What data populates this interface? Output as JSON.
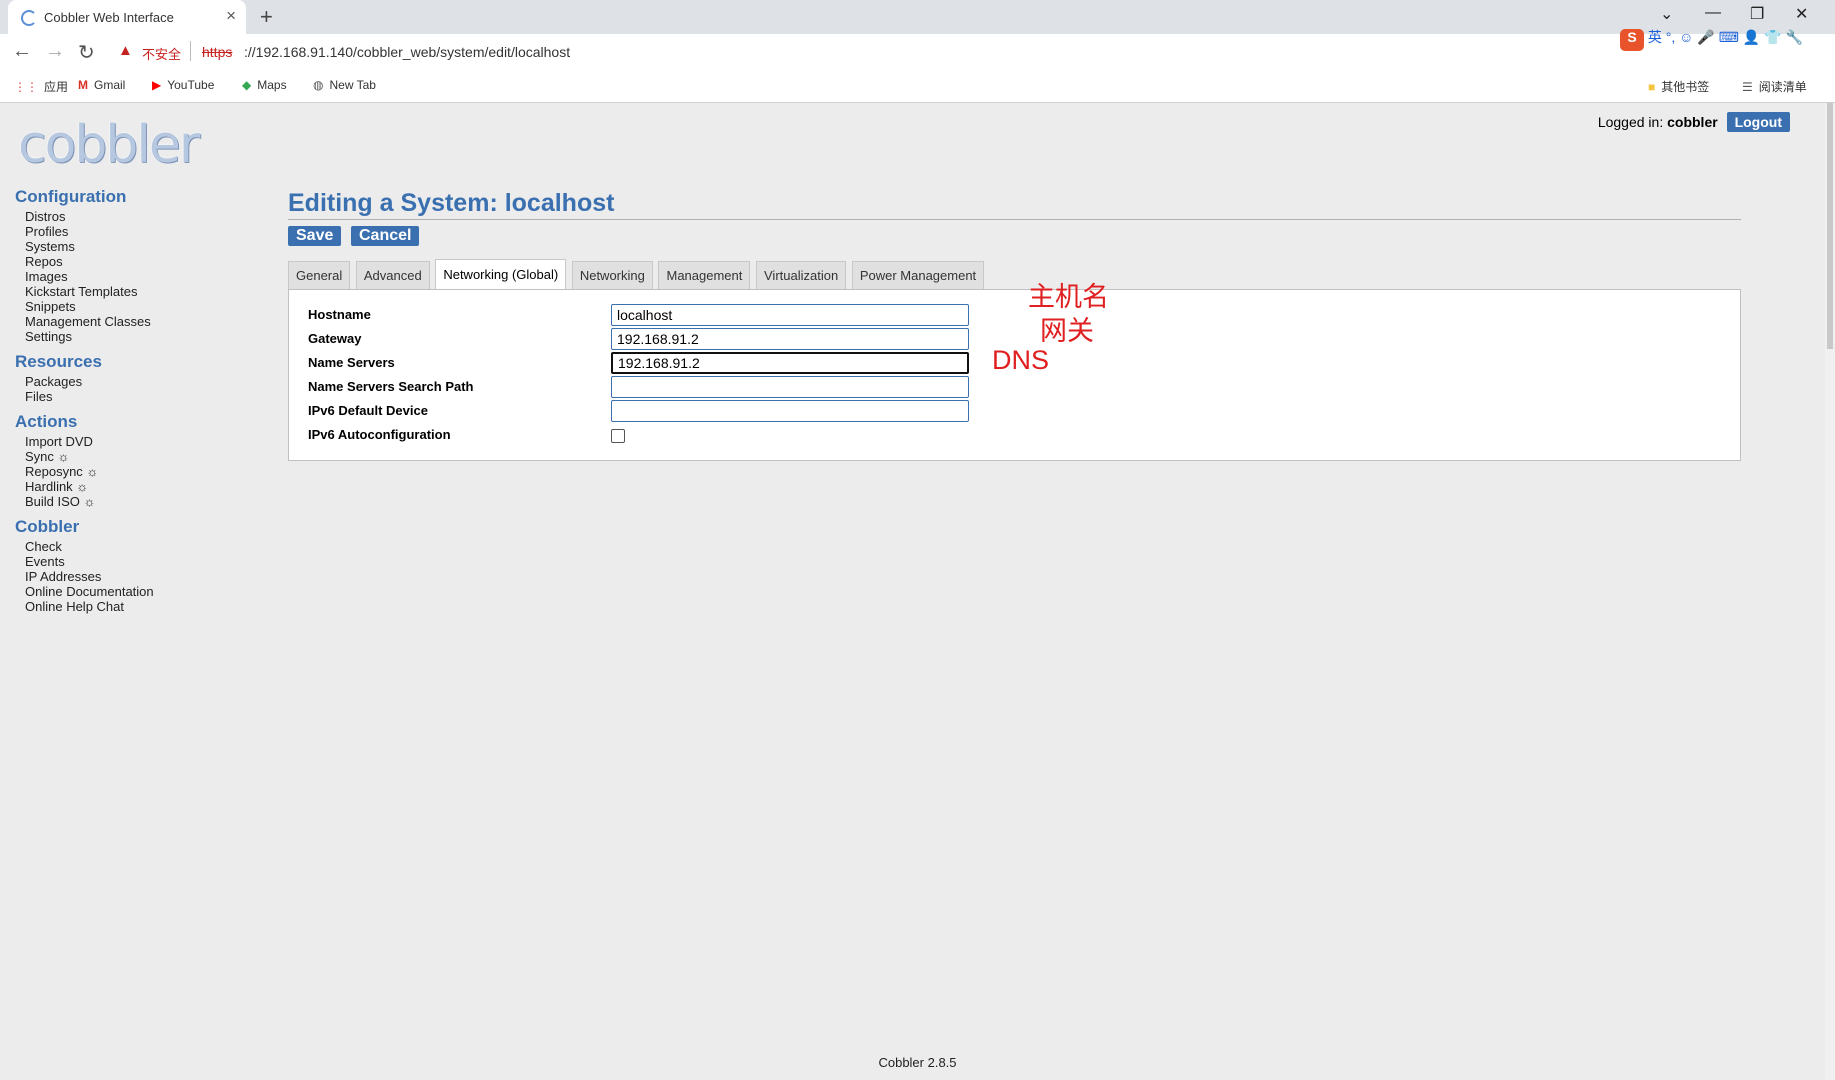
{
  "browser": {
    "tab_title": "Cobbler Web Interface",
    "insecure_label": "不安全",
    "url_scheme": "https",
    "url_rest": "://192.168.91.140/cobbler_web/system/edit/localhost",
    "bookmarks": [
      "应用",
      "Gmail",
      "YouTube",
      "Maps",
      "New Tab"
    ],
    "bookmarks_right": [
      "其他书签",
      "阅读清单"
    ],
    "ime_label": "英"
  },
  "header": {
    "logo_text": "cobbler",
    "logged_in_label": "Logged in:",
    "username": "cobbler",
    "logout_label": "Logout"
  },
  "sidebar": {
    "sections": [
      {
        "title": "Configuration",
        "items": [
          "Distros",
          "Profiles",
          "Systems",
          "Repos",
          "Images",
          "Kickstart Templates",
          "Snippets",
          "Management Classes",
          "Settings"
        ]
      },
      {
        "title": "Resources",
        "items": [
          "Packages",
          "Files"
        ]
      },
      {
        "title": "Actions",
        "items": [
          "Import DVD",
          "Sync ☼",
          "Reposync ☼",
          "Hardlink ☼",
          "Build ISO ☼"
        ]
      },
      {
        "title": "Cobbler",
        "items": [
          "Check",
          "Events",
          "IP Addresses",
          "Online Documentation",
          "Online Help Chat"
        ]
      }
    ]
  },
  "main": {
    "title": "Editing a System: localhost",
    "save_label": "Save",
    "cancel_label": "Cancel",
    "tabs": [
      "General",
      "Advanced",
      "Networking (Global)",
      "Networking",
      "Management",
      "Virtualization",
      "Power Management"
    ],
    "active_tab": "Networking (Global)",
    "fields": {
      "hostname": {
        "label": "Hostname",
        "value": "localhost"
      },
      "gateway": {
        "label": "Gateway",
        "value": "192.168.91.2"
      },
      "name_servers": {
        "label": "Name Servers",
        "value": "192.168.91.2"
      },
      "search_path": {
        "label": "Name Servers Search Path",
        "value": ""
      },
      "ipv6_device": {
        "label": "IPv6 Default Device",
        "value": ""
      },
      "ipv6_autoconf": {
        "label": "IPv6 Autoconfiguration",
        "checked": false
      }
    }
  },
  "annotations": {
    "hostname": "主机名",
    "gateway": "网关",
    "dns": "DNS"
  },
  "footer": {
    "version": "Cobbler 2.8.5"
  },
  "colors": {
    "accent": "#3a6fb0",
    "annotation": "#e02020",
    "background": "#ececec"
  }
}
